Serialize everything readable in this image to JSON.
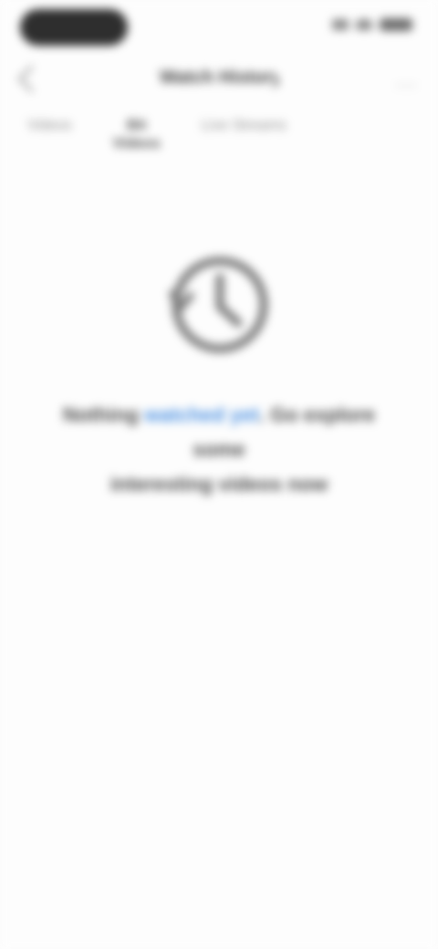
{
  "header": {
    "title": "Watch History",
    "more_glyph": "···"
  },
  "tabs": [
    {
      "label": "Videos",
      "active": false
    },
    {
      "label": "Bit Videos",
      "active": true
    },
    {
      "label": "Live Streams",
      "active": false
    }
  ],
  "empty_state": {
    "icon": "history-icon",
    "text_before": "Nothing ",
    "link_text": "watched yet",
    "text_after": ". Go explore some",
    "second_line": "interesting videos now"
  },
  "colors": {
    "link": "#4a90e2",
    "status_pill": "#2e2e2e"
  }
}
